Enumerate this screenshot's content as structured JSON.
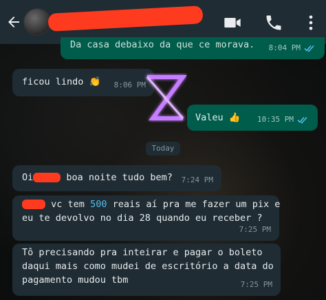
{
  "header": {
    "contact_name": "",
    "icons": [
      "back-arrow-icon",
      "video-call-icon",
      "phone-icon",
      "more-vertical-icon"
    ]
  },
  "colors": {
    "header_bg": "#1f2c33",
    "incoming_bg": "#1f2c33",
    "outgoing_bg": "#005c4b",
    "read_ticks": "#53bdeb",
    "redaction": "#ff3b1f"
  },
  "messages": [
    {
      "direction": "outgoing",
      "text": "Da casa debaixo da que ce morava.",
      "time": "8:04 PM",
      "status": "read"
    },
    {
      "direction": "incoming",
      "text": "ficou lindo 👏",
      "time": "8:06 PM"
    },
    {
      "direction": "outgoing",
      "text": "Valeu 👍",
      "time": "10:35 PM",
      "status": "read"
    },
    {
      "direction": "incoming",
      "text_before": "Oi",
      "text_after": "boa noite tudo bem?",
      "time": "7:24 PM"
    },
    {
      "direction": "incoming",
      "line1_after_redaction": "vc tem",
      "amount": "500",
      "line1_end": "reais aí pra me fazer um pix e",
      "line2": "eu te devolvo no dia 28 quando eu receber ?",
      "time": "7:25 PM"
    },
    {
      "direction": "incoming",
      "lines": [
        "Tô precisando pra inteirar e pagar o boleto",
        "daqui mais como mudei de escritório a data do",
        "pagamento mudou tbm"
      ],
      "time": "7:25 PM"
    }
  ],
  "date_separator": "Today"
}
